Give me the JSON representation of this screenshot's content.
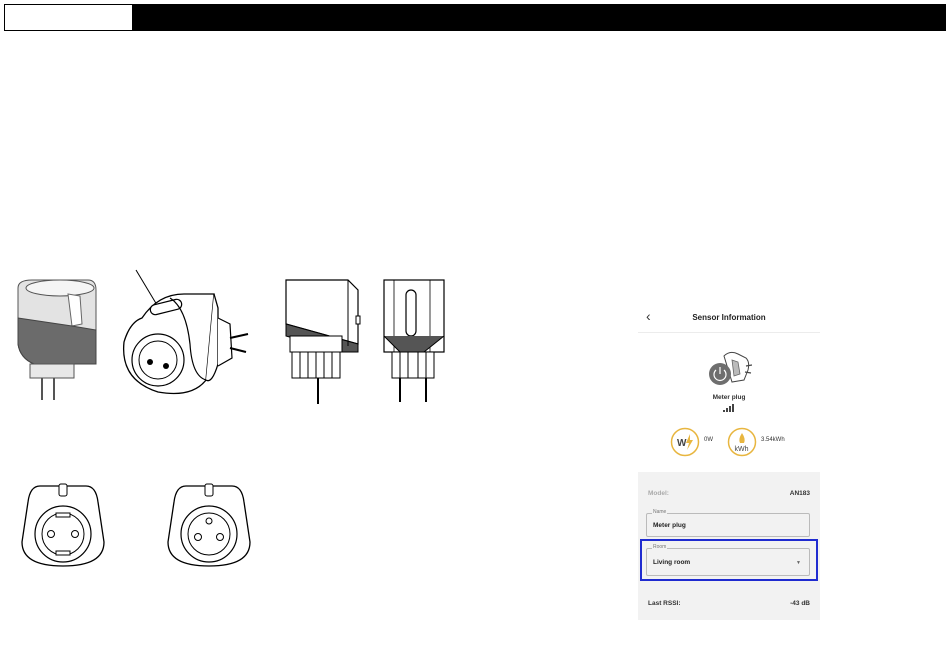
{
  "sensor": {
    "title": "Sensor Information",
    "back_icon": "chevron-left-icon",
    "device_name": "Meter plug",
    "power_value": "0W",
    "energy_value": "3.54kWh",
    "power_icon": "watt-lightning-icon",
    "energy_icon": "kwh-drop-icon",
    "model_label": "Model:",
    "model_value": "AN183",
    "name_field_label": "Name",
    "name_field_value": "Meter plug",
    "room_field_label": "Room",
    "room_field_value": "Living room",
    "rssi_label": "Last RSSI:",
    "rssi_value": "-43 dB"
  },
  "colors": {
    "accent_gold": "#e8b640",
    "highlight_blue": "#1f2bd0",
    "card_bg": "#f2f2f2"
  }
}
